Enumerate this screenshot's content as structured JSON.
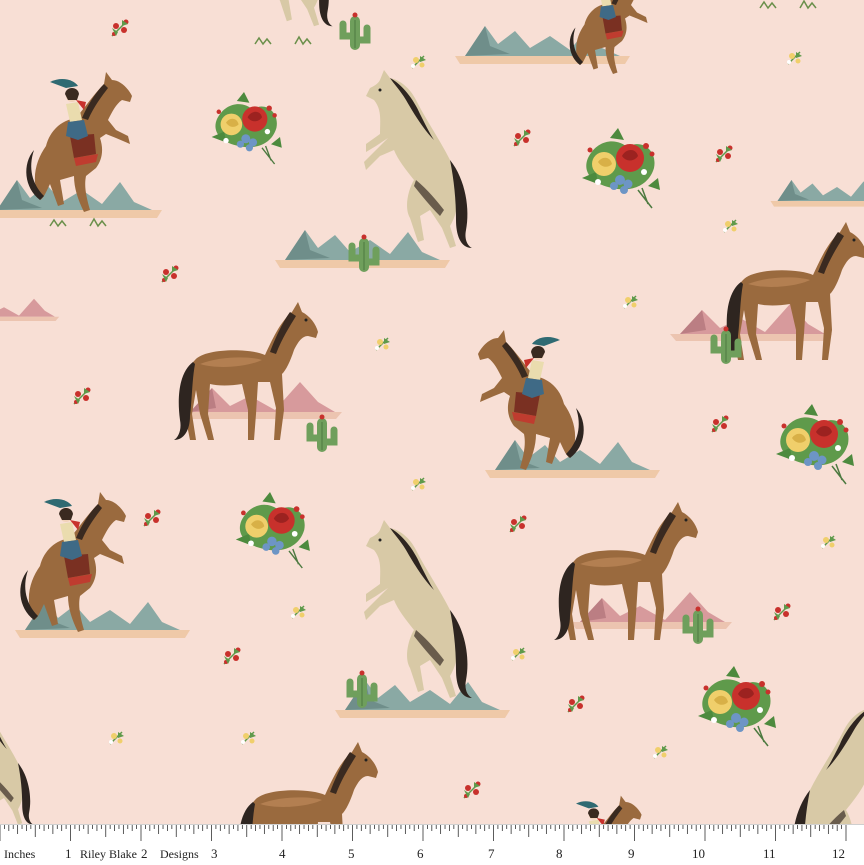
{
  "fabric": {
    "background": "#f8dfd5",
    "motifs": [
      "horse-with-cowgirl",
      "rearing-palomino",
      "standing-bay-horse",
      "rose-bouquet",
      "flower-sprig",
      "cactus",
      "mountains"
    ]
  },
  "ruler": {
    "units_label": "Inches",
    "brand_left": "Riley Blake",
    "brand_right": "Designs",
    "numbers": [
      "1",
      "2",
      "3",
      "4",
      "5",
      "6",
      "7",
      "8",
      "9",
      "10",
      "11",
      "12"
    ]
  },
  "colors": {
    "horse_brown": "#9a6a3e",
    "horse_dark": "#2e2520",
    "palomino": "#d8c9a6",
    "mountain_blue": "#8aa9a4",
    "mountain_pink": "#d79a9c",
    "cactus_green": "#6f9f5c",
    "rose_red": "#c8312c",
    "rose_yellow": "#f0cf6b",
    "forget_me_not": "#6d95c5",
    "leaf_green": "#5f9a4b"
  }
}
